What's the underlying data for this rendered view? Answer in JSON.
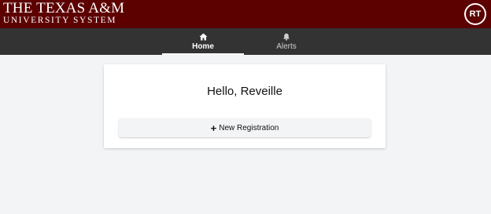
{
  "header": {
    "logo_line1": "THE TEXAS A&M",
    "logo_line2": "UNIVERSITY SYSTEM",
    "avatar_initials": "RT",
    "brand_color": "#5c0000"
  },
  "nav": {
    "tabs": [
      {
        "label": "Home",
        "icon": "home-icon",
        "active": true
      },
      {
        "label": "Alerts",
        "icon": "bell-icon",
        "active": false
      }
    ]
  },
  "main": {
    "greeting": "Hello, Reveille",
    "new_registration_label": "New Registration",
    "new_registration_icon": "plus-icon"
  }
}
